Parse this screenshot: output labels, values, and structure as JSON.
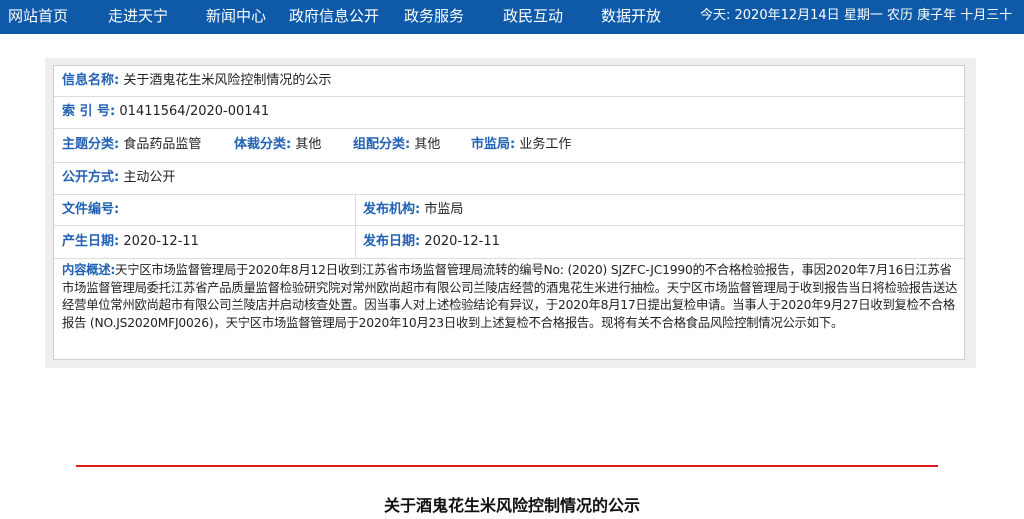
{
  "nav": {
    "items": [
      "网站首页",
      "走进天宁",
      "新闻中心",
      "政府信息公开",
      "政务服务",
      "政民互动",
      "数据开放"
    ],
    "date_text": "今天: 2020年12月14日 星期一 农历 庚子年 十月三十"
  },
  "info": {
    "name_label": "信息名称:",
    "name_value": "关于酒鬼花生米风险控制情况的公示",
    "index_label": "索 引 号:",
    "index_value": "01411564/2020-00141",
    "topic_label": "主题分类:",
    "topic_value": "食品药品监管",
    "genre_label": "体裁分类:",
    "genre_value": "其他",
    "org_cat_label": "组配分类:",
    "org_cat_value": "其他",
    "bureau_label": "市监局:",
    "bureau_value": "业务工作",
    "disclosure_label": "公开方式:",
    "disclosure_value": "主动公开",
    "docno_label": "文件编号:",
    "docno_value": "",
    "publisher_label": "发布机构:",
    "publisher_value": "市监局",
    "created_label": "产生日期:",
    "created_value": "2020-12-11",
    "published_label": "发布日期:",
    "published_value": "2020-12-11",
    "summary_label": "内容概述:",
    "summary_value": "天宁区市场监督管理局于2020年8月12日收到江苏省市场监督管理局流转的编号No: (2020) SJZFC-JC1990的不合格检验报告，事因2020年7月16日江苏省市场监督管理局委托江苏省产品质量监督检验研究院对常州欧尚超市有限公司兰陵店经营的酒鬼花生米进行抽检。天宁区市场监督管理局于收到报告当日将检验报告送达经营单位常州欧尚超市有限公司兰陵店并启动核查处置。因当事人对上述检验结论有异议，于2020年8月17日提出复检申请。当事人于2020年9月27日收到复检不合格报告 (NO.JS2020MFJ0026)，天宁区市场监督管理局于2020年10月23日收到上述复检不合格报告。现将有关不合格食品风险控制情况公示如下。"
  },
  "doc_title": "关于酒鬼花生米风险控制情况的公示"
}
